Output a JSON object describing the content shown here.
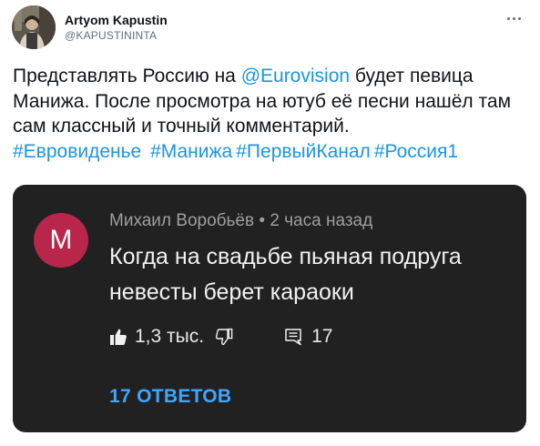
{
  "tweet": {
    "display_name": "Artyom Kapustin",
    "handle": "@KAPUSTININTA",
    "text": {
      "part1": "Представлять Россию на ",
      "mention": "@Eurovision",
      "part2": " будет певица Манижа. После просмотра на ютуб её песни нашёл там сам классный и точный комментарий.",
      "hashtags": [
        "#Евровиденье",
        "#Манижа",
        "#ПервыйКанал",
        "#Россия1"
      ]
    }
  },
  "youtube_comment": {
    "avatar_letter": "M",
    "author": "Михаил Воробьёв",
    "separator": " • ",
    "time": "2 часа назад",
    "text": "Когда на свадьбе пьяная подруга невесты берет караоки",
    "likes": "1,3 тыс.",
    "replies_count": "17",
    "replies_label": "17 ОТВЕТОВ"
  },
  "colors": {
    "link": "#1b95e0",
    "card_bg": "#212121",
    "comment_avatar": "#b8264b",
    "replies_link": "#3ea6ff"
  },
  "icons": [
    "more-icon",
    "thumbs-up-icon",
    "thumbs-down-icon",
    "comment-icon"
  ]
}
